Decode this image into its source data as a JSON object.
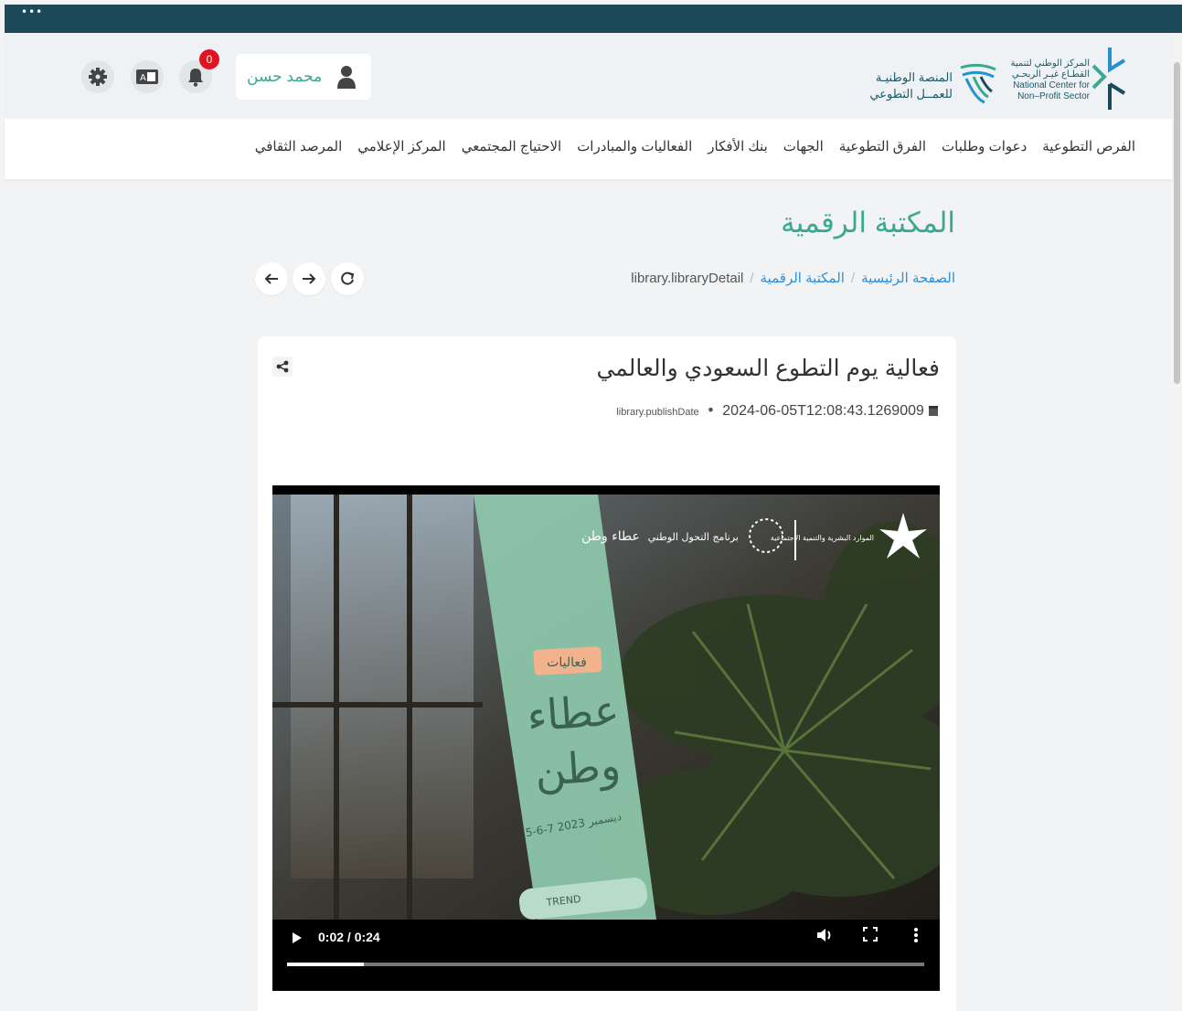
{
  "window": {
    "menu_dots": "•••"
  },
  "header": {
    "org_logo_lines": [
      "المركز الوطني لتنمية",
      "القطـاع غيـر الربحـي",
      "National Center for",
      "Non–Profit Sector"
    ],
    "platform_logo_lines": [
      "المنصة الوطنيـة",
      "للعمــل التطوعي"
    ],
    "user_name": "محمد حسن",
    "notification_count": "0"
  },
  "nav": {
    "items": [
      "الفرص التطوعية",
      "دعوات وطلبات",
      "الفرق التطوعية",
      "الجهات",
      "بنك الأفكار",
      "الفعاليات والمبادرات",
      "الاحتياج المجتمعي",
      "المركز الإعلامي",
      "المرصد الثقافي"
    ]
  },
  "page": {
    "title": "المكتبة الرقمية",
    "breadcrumb": {
      "home": "الصفحة الرئيسية",
      "library": "المكتبة الرقمية",
      "current": "library.libraryDetail"
    }
  },
  "article": {
    "title": "فعالية يوم التطوع السعودي والعالمي",
    "publish_label": "library.publishDate",
    "publish_date": "2024-06-05T12:08:43.1269009"
  },
  "video": {
    "time_display": "0:02 / 0:24",
    "progress_fraction": 0.12,
    "banner_text": {
      "tag": "فعاليات",
      "headline": [
        "عطاء",
        "وطن"
      ],
      "dates": "5-6-7 ديسمبر 2023",
      "brand_top": "عطاء وطن",
      "ministry": "الموارد البشرية والتنمية الاجتماعية",
      "program": "برنامج التحول الوطني",
      "sponsor": "TREND"
    }
  },
  "colors": {
    "brand_green": "#3ba88f",
    "topbar": "#1b4b5a",
    "link_blue": "#2f8fd6",
    "badge_red": "#e0141f"
  }
}
